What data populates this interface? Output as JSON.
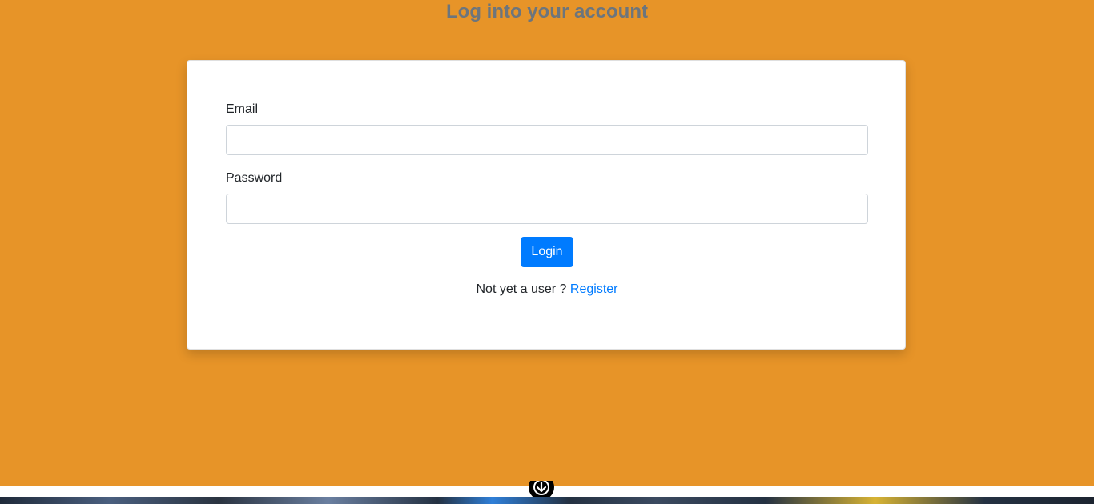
{
  "page": {
    "title": "Log into your account",
    "background_color": "#e79428"
  },
  "form": {
    "email_label": "Email",
    "email_value": "",
    "password_label": "Password",
    "password_value": "",
    "login_button": "Login",
    "register_prompt": "Not yet a user ?",
    "register_link": "Register"
  },
  "colors": {
    "primary": "#007bff",
    "title": "#6c757d"
  },
  "icons": {
    "floating": "download-arrow-icon"
  }
}
